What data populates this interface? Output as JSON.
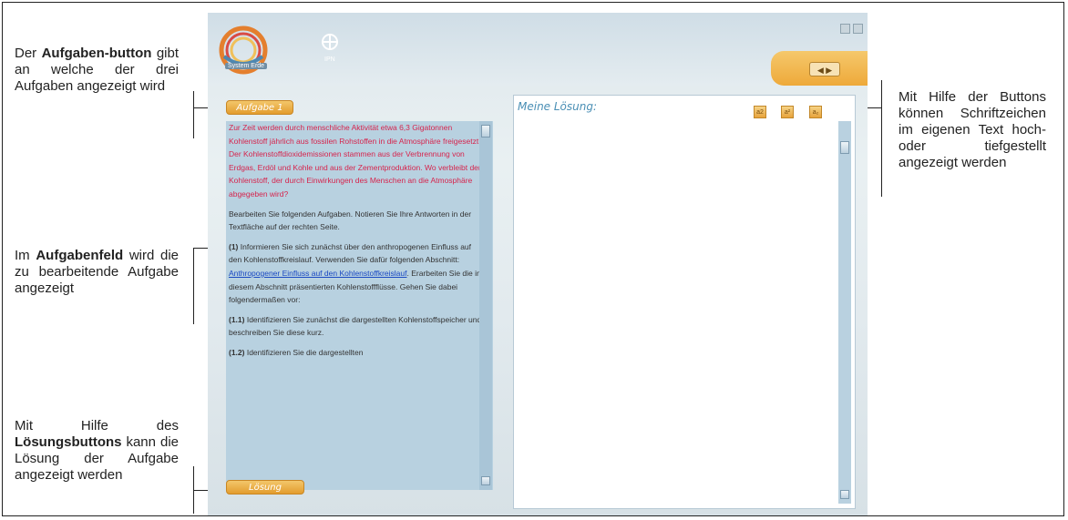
{
  "annotations": {
    "aufgabenbutton": {
      "pre": "Der ",
      "bold": "Aufgaben-button",
      "post": " gibt an welche der drei Aufgaben angezeigt wird"
    },
    "aufgabenfeld": {
      "pre": "Im ",
      "bold": "Aufgabenfeld",
      "post": " wird die zu bearbeitende Aufgabe angezeigt"
    },
    "loesungsbutton": {
      "pre": "Mit Hilfe des ",
      "bold": "Lösungsbuttons",
      "post": " kann die Lösung der Aufgabe angezeigt werden"
    },
    "formatbuttons": {
      "text": "Mit Hilfe der Buttons können Schriftzeichen im eigenen Text hoch- oder tiefgestellt angezeigt werden"
    }
  },
  "app": {
    "logo_label": "System Erde",
    "ipn_label": "IPN",
    "nav_arrows": "◀ ▶",
    "task_tab_label": "Aufgabe 1",
    "solution_button_label": "Lösung",
    "solution_title": "Meine Lösung:",
    "format_buttons": [
      "a2",
      "a²",
      "a₂"
    ],
    "task": {
      "intro_red": "Zur Zeit werden durch menschliche Aktivität etwa 6,3 Gigatonnen Kohlenstoff jährlich aus fossilen Rohstoffen in die Atmosphäre freigesetzt. Der Kohlenstoffdioxidemissionen stammen aus der Verbrennung von Erdgas, Erdöl und Kohle und aus der Zementproduktion. Wo verbleibt der Kohlenstoff, der durch Einwirkungen des Menschen an die Atmosphäre abgegeben wird?",
      "p1": "Bearbeiten Sie folgenden Aufgaben. Notieren Sie Ihre Antworten in der Textfläche auf der rechten Seite.",
      "p2_num": "(1)",
      "p2_text": " Informieren Sie sich zunächst über den anthropogenen Einfluss auf den Kohlenstoffkreislauf. Verwenden Sie dafür folgenden Abschnitt:",
      "p2_link": "Anthropogener Einfluss auf den Kohlenstoffkreislauf",
      "p2_rest": ". Erarbeiten Sie die in diesem Abschnitt präsentierten Kohlenstoffflüsse. Gehen Sie dabei folgendermaßen vor:",
      "p3_num": "(1.1)",
      "p3_text": " Identifizieren Sie zunächst die dargestellten Kohlenstoffspeicher und beschreiben Sie diese kurz.",
      "p4_num": "(1.2)",
      "p4_text": " Identifizieren Sie die dargestellten"
    }
  },
  "colors": {
    "accent_gold": "#eea93a",
    "task_red": "#d6244d",
    "link_blue": "#1a49c2",
    "panel_blue": "#b8d1e0",
    "title_blue": "#4a8fb5"
  }
}
